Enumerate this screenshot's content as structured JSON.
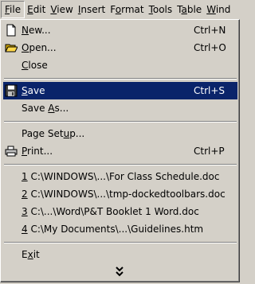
{
  "menubar": {
    "items": [
      {
        "pre": "",
        "acc": "F",
        "post": "ile"
      },
      {
        "pre": "",
        "acc": "E",
        "post": "dit"
      },
      {
        "pre": "",
        "acc": "V",
        "post": "iew"
      },
      {
        "pre": "",
        "acc": "I",
        "post": "nsert"
      },
      {
        "pre": "F",
        "acc": "o",
        "post": "rmat"
      },
      {
        "pre": "",
        "acc": "T",
        "post": "ools"
      },
      {
        "pre": "T",
        "acc": "a",
        "post": "ble"
      },
      {
        "pre": "",
        "acc": "W",
        "post": "ind"
      }
    ]
  },
  "menu": {
    "new": {
      "pre": "",
      "acc": "N",
      "post": "ew...",
      "shortcut": "Ctrl+N"
    },
    "open": {
      "pre": "",
      "acc": "O",
      "post": "pen...",
      "shortcut": "Ctrl+O"
    },
    "close": {
      "pre": "",
      "acc": "C",
      "post": "lose"
    },
    "save": {
      "pre": "",
      "acc": "S",
      "post": "ave",
      "shortcut": "Ctrl+S"
    },
    "save_as": {
      "pre": "Save ",
      "acc": "A",
      "post": "s..."
    },
    "page_setup": {
      "pre": "Page Set",
      "acc": "u",
      "post": "p..."
    },
    "print": {
      "pre": "",
      "acc": "P",
      "post": "rint...",
      "shortcut": "Ctrl+P"
    },
    "recent": [
      {
        "acc": "1",
        "post": " C:\\WINDOWS\\...\\For Class Schedule.doc"
      },
      {
        "acc": "2",
        "post": " C:\\WINDOWS\\...\\tmp-dockedtoolbars.doc"
      },
      {
        "acc": "3",
        "post": " C:\\...\\Word\\P&T Booklet 1 Word.doc"
      },
      {
        "acc": "4",
        "post": " C:\\My Documents\\...\\Guidelines.htm"
      }
    ],
    "exit": {
      "pre": "E",
      "acc": "x",
      "post": "it"
    }
  },
  "colors": {
    "highlight": "#0a246a",
    "face": "#d4d0c8"
  },
  "icons": {
    "new": "new-document-icon",
    "open": "open-folder-icon",
    "save": "floppy-disk-icon",
    "print": "printer-icon",
    "more": "double-chevron-down-icon"
  }
}
